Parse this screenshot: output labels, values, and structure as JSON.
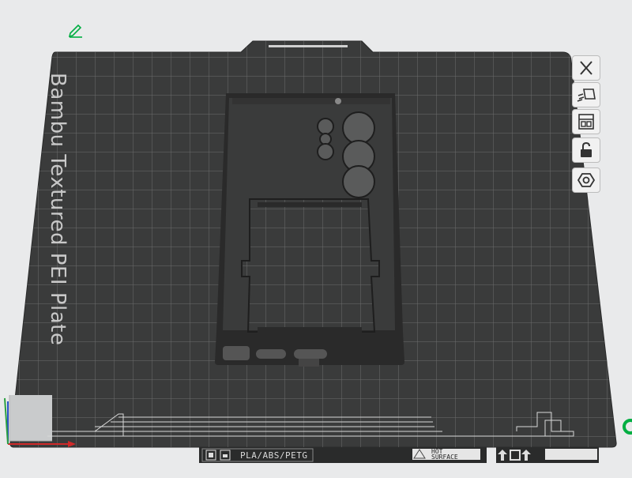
{
  "plate": {
    "label": "Bambu Textured PEI Plate",
    "filament_label": "PLA/ABS/PETG",
    "hot_surface_line1": "HOT",
    "hot_surface_line2": "SURFACE"
  },
  "toolbar": {
    "items": [
      {
        "name": "close-icon"
      },
      {
        "name": "auto-orient-icon"
      },
      {
        "name": "arrange-icon"
      },
      {
        "name": "lock-icon"
      },
      {
        "name": "settings-icon"
      }
    ]
  },
  "colors": {
    "plate": "#3a3b3b",
    "grid": "#6a6b6b",
    "model": "#2a2a2a",
    "accent": "#00ae42"
  }
}
